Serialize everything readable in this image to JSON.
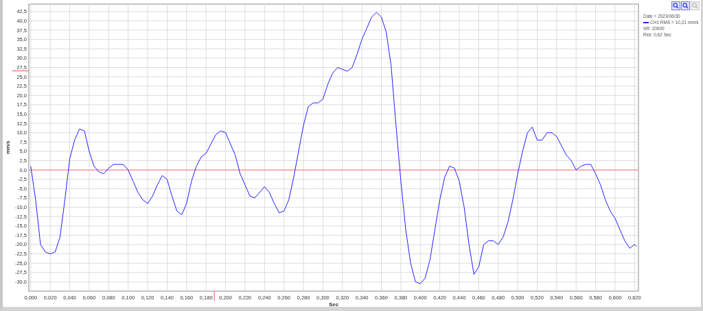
{
  "toolbar": [
    {
      "disabled": false
    },
    {
      "disabled": false
    },
    {
      "disabled": true
    }
  ],
  "legend": {
    "header": "Date = 2023/06/30",
    "footer": [
      "SR: 20000",
      "Res: 0,62 Sec"
    ]
  },
  "chart_data": {
    "type": "line",
    "xlabel": "Sec",
    "ylabel": "mm/s",
    "grid": true,
    "xlim": [
      -0.002,
      0.624
    ],
    "ylim": [
      -32.5,
      44.5
    ],
    "x": [
      0,
      0.005,
      0.01,
      0.015,
      0.02,
      0.025,
      0.03,
      0.035,
      0.04,
      0.045,
      0.05,
      0.055,
      0.06,
      0.065,
      0.07,
      0.075,
      0.08,
      0.085,
      0.09,
      0.095,
      0.1,
      0.105,
      0.11,
      0.115,
      0.12,
      0.125,
      0.13,
      0.135,
      0.14,
      0.145,
      0.15,
      0.155,
      0.16,
      0.165,
      0.17,
      0.175,
      0.18,
      0.185,
      0.19,
      0.195,
      0.2,
      0.205,
      0.21,
      0.215,
      0.22,
      0.225,
      0.23,
      0.235,
      0.24,
      0.245,
      0.25,
      0.255,
      0.26,
      0.265,
      0.27,
      0.275,
      0.28,
      0.285,
      0.29,
      0.295,
      0.3,
      0.305,
      0.31,
      0.315,
      0.32,
      0.325,
      0.33,
      0.335,
      0.34,
      0.345,
      0.35,
      0.355,
      0.36,
      0.365,
      0.37,
      0.375,
      0.38,
      0.385,
      0.39,
      0.395,
      0.4,
      0.405,
      0.41,
      0.415,
      0.42,
      0.425,
      0.43,
      0.435,
      0.44,
      0.445,
      0.45,
      0.455,
      0.46,
      0.465,
      0.47,
      0.475,
      0.48,
      0.485,
      0.49,
      0.495,
      0.5,
      0.505,
      0.51,
      0.515,
      0.52,
      0.525,
      0.53,
      0.535,
      0.54,
      0.545,
      0.55,
      0.555,
      0.56,
      0.565,
      0.57,
      0.575,
      0.58,
      0.585,
      0.59,
      0.595,
      0.6,
      0.605,
      0.61,
      0.615,
      0.62,
      0.622
    ],
    "series": [
      {
        "name": "CH1 RMS = 10,21 mm/s",
        "color": "#2020ff",
        "values": [
          1,
          -8,
          -20,
          -22,
          -22.5,
          -22,
          -18,
          -8,
          3,
          8,
          11,
          10.5,
          5,
          1,
          -0.5,
          -1,
          0.5,
          1.5,
          1.5,
          1.5,
          0,
          -3,
          -6,
          -8,
          -9,
          -7,
          -4,
          -1.5,
          -2.5,
          -7,
          -11,
          -12,
          -9,
          -3,
          1,
          3.5,
          4.5,
          7,
          9.5,
          10.5,
          10,
          7,
          4,
          -1,
          -4,
          -7,
          -7.5,
          -6,
          -4.5,
          -6,
          -9,
          -11.5,
          -11,
          -8,
          -2,
          5,
          12,
          17,
          18,
          18,
          19,
          23,
          26,
          27.5,
          27,
          26.5,
          27.5,
          31,
          35,
          38,
          41,
          42.3,
          41,
          37,
          28,
          12,
          -3,
          -16,
          -25,
          -30,
          -30.5,
          -29,
          -24,
          -16,
          -8,
          -2,
          1,
          0.5,
          -3,
          -10,
          -20,
          -28,
          -26,
          -20,
          -19,
          -19,
          -20,
          -18,
          -14,
          -8,
          -1,
          5,
          10,
          11.5,
          8,
          8,
          10,
          10,
          9,
          6.5,
          4,
          2.5,
          0,
          1,
          1.5,
          1.5,
          -1,
          -4,
          -8,
          -11,
          -13,
          -16,
          -19,
          -21,
          -20,
          -20.5
        ]
      }
    ],
    "xticks": [
      {
        "value": 0,
        "label": "0,000"
      },
      {
        "value": 0.02,
        "label": "0,020"
      },
      {
        "value": 0.04,
        "label": "0,040"
      },
      {
        "value": 0.06,
        "label": "0,060"
      },
      {
        "value": 0.08,
        "label": "0,080"
      },
      {
        "value": 0.1,
        "label": "0,100"
      },
      {
        "value": 0.12,
        "label": "0,120"
      },
      {
        "value": 0.14,
        "label": "0,140"
      },
      {
        "value": 0.16,
        "label": "0,160"
      },
      {
        "value": 0.18,
        "label": "0,180"
      },
      {
        "value": 0.2,
        "label": "0,200"
      },
      {
        "value": 0.22,
        "label": "0,220"
      },
      {
        "value": 0.24,
        "label": "0,240"
      },
      {
        "value": 0.26,
        "label": "0,260"
      },
      {
        "value": 0.28,
        "label": "0,280"
      },
      {
        "value": 0.3,
        "label": "0,300"
      },
      {
        "value": 0.32,
        "label": "0,320"
      },
      {
        "value": 0.34,
        "label": "0,340"
      },
      {
        "value": 0.36,
        "label": "0,360"
      },
      {
        "value": 0.38,
        "label": "0,380"
      },
      {
        "value": 0.4,
        "label": "0,400"
      },
      {
        "value": 0.42,
        "label": "0,420"
      },
      {
        "value": 0.44,
        "label": "0,440"
      },
      {
        "value": 0.46,
        "label": "0,460"
      },
      {
        "value": 0.48,
        "label": "0,480"
      },
      {
        "value": 0.5,
        "label": "0,500"
      },
      {
        "value": 0.52,
        "label": "0,520"
      },
      {
        "value": 0.54,
        "label": "0,540"
      },
      {
        "value": 0.56,
        "label": "0,560"
      },
      {
        "value": 0.58,
        "label": "0,580"
      },
      {
        "value": 0.6,
        "label": "0,600"
      },
      {
        "value": 0.62,
        "label": "0,620"
      }
    ],
    "yticks": [
      {
        "value": -30,
        "label": "-30,0"
      },
      {
        "value": -27.5,
        "label": "-27,5"
      },
      {
        "value": -25,
        "label": "-25,0"
      },
      {
        "value": -22.5,
        "label": "-22,5"
      },
      {
        "value": -20,
        "label": "-20,0"
      },
      {
        "value": -17.5,
        "label": "-17,5"
      },
      {
        "value": -15,
        "label": "-15,0"
      },
      {
        "value": -12.5,
        "label": "-12,5"
      },
      {
        "value": -10,
        "label": "-10,0"
      },
      {
        "value": -7.5,
        "label": "-7,5"
      },
      {
        "value": -5,
        "label": "-5,0"
      },
      {
        "value": -2.5,
        "label": "-2,5"
      },
      {
        "value": 0,
        "label": "0,0"
      },
      {
        "value": 2.5,
        "label": "2,5"
      },
      {
        "value": 5,
        "label": "5,0"
      },
      {
        "value": 7.5,
        "label": "7,5"
      },
      {
        "value": 10,
        "label": "10,0"
      },
      {
        "value": 12.5,
        "label": "12,5"
      },
      {
        "value": 15,
        "label": "15,0"
      },
      {
        "value": 17.5,
        "label": "17,5"
      },
      {
        "value": 20,
        "label": "20,0"
      },
      {
        "value": 22.5,
        "label": "22,5"
      },
      {
        "value": 25,
        "label": "25,0"
      },
      {
        "value": 27.5,
        "label": "27,5"
      },
      {
        "value": 30,
        "label": "30,0"
      },
      {
        "value": 32.5,
        "label": "32,5"
      },
      {
        "value": 35,
        "label": "35,0"
      },
      {
        "value": 37.5,
        "label": "37,5"
      },
      {
        "value": 40,
        "label": "40,0"
      },
      {
        "value": 42.5,
        "label": "42,5"
      }
    ],
    "ref_lines": [
      {
        "axis": "y",
        "value": 0,
        "color": "#ff7070"
      }
    ]
  }
}
